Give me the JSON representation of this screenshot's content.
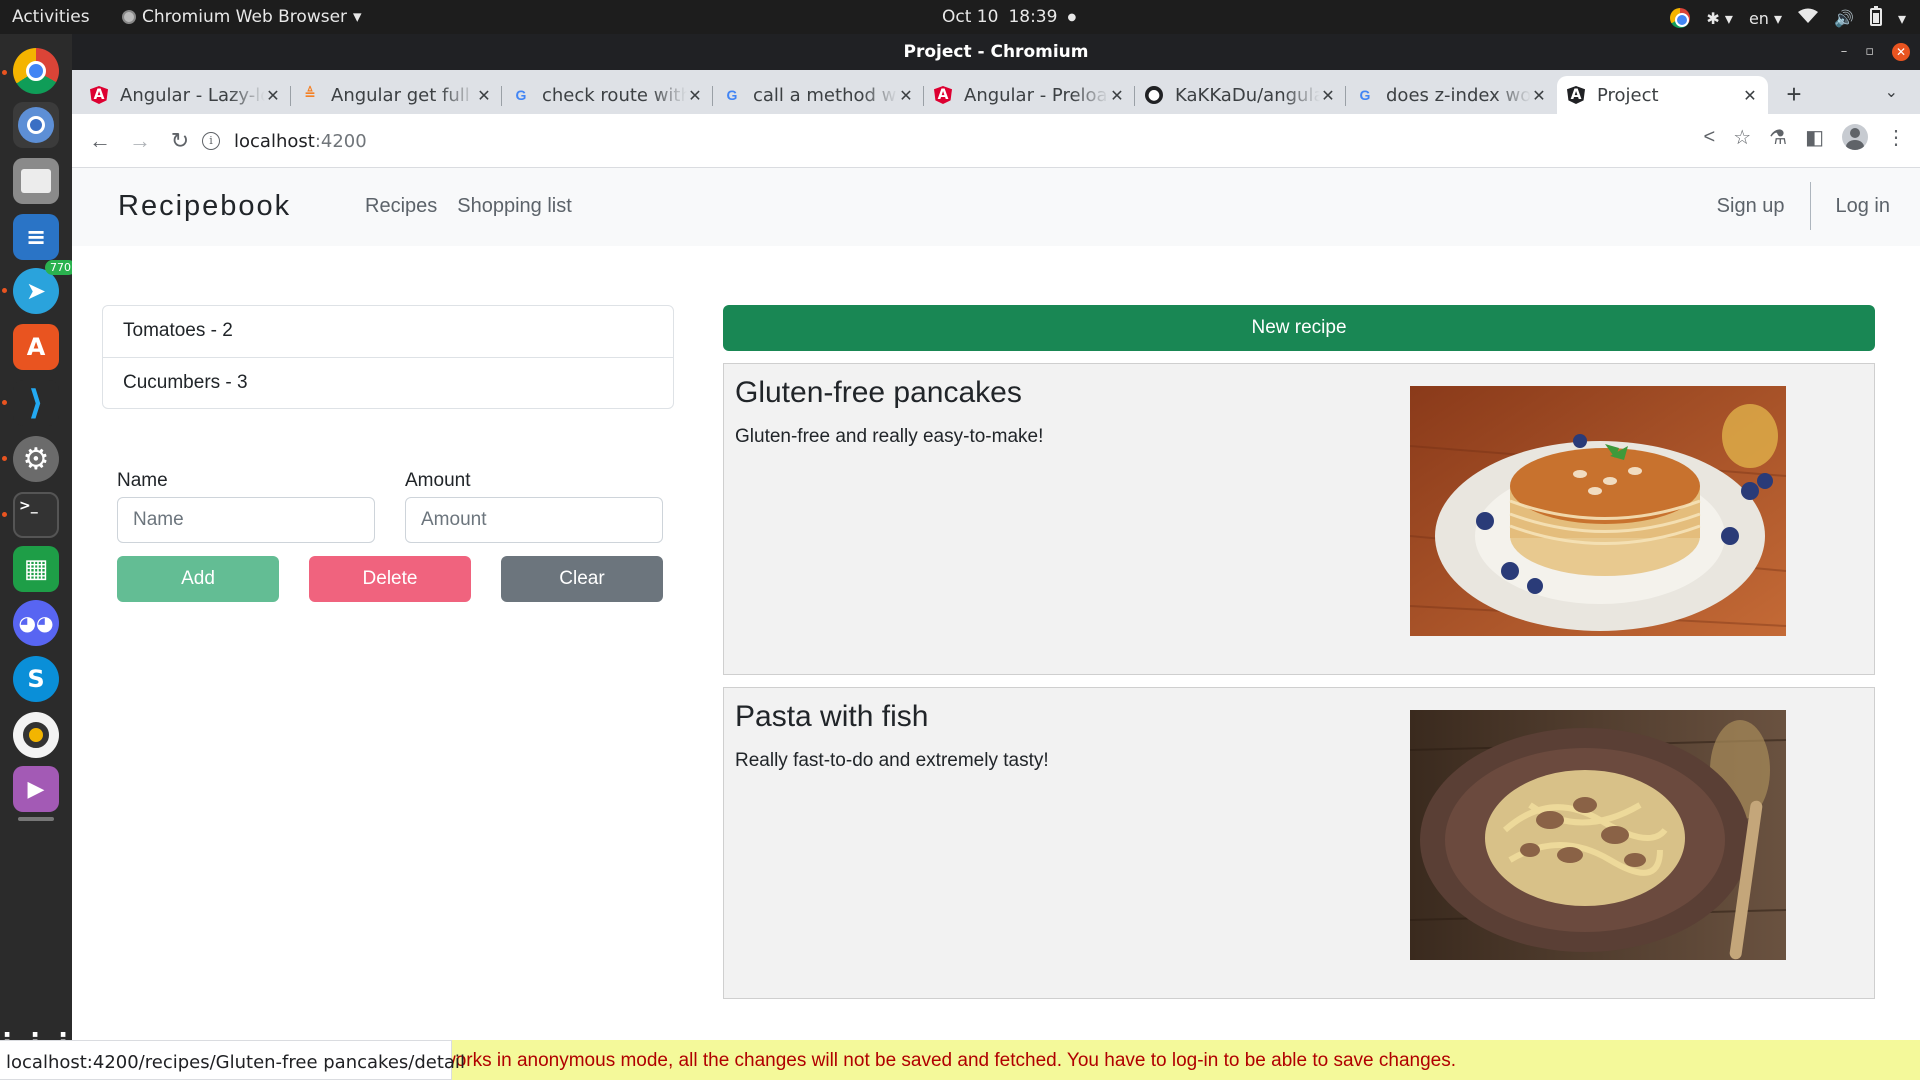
{
  "system": {
    "activities": "Activities",
    "app_name": "Chromium Web Browser",
    "date": "Oct 10",
    "time": "18:39",
    "language": "en"
  },
  "dock": {
    "telegram_badge": "770"
  },
  "window": {
    "title": "Project - Chromium"
  },
  "tabs": [
    {
      "title": "Angular - Lazy-loading",
      "icon": "angular-icon"
    },
    {
      "title": "Angular get full url",
      "icon": "stackoverflow-icon"
    },
    {
      "title": "check route with",
      "icon": "google-icon"
    },
    {
      "title": "call a method when",
      "icon": "google-icon"
    },
    {
      "title": "Angular - Preloading",
      "icon": "angular-icon"
    },
    {
      "title": "KaKKaDu/angular",
      "icon": "github-icon"
    },
    {
      "title": "does z-index work",
      "icon": "google-icon"
    },
    {
      "title": "Project",
      "icon": "angular-icon",
      "active": true
    }
  ],
  "address_bar": {
    "host": "localhost",
    "port": ":4200"
  },
  "app": {
    "brand": "Recipebook",
    "nav": {
      "recipes": "Recipes",
      "shopping_list": "Shopping list"
    },
    "auth": {
      "signup": "Sign up",
      "login": "Log in"
    },
    "ingredients": [
      "Tomatoes - 2",
      "Cucumbers - 3"
    ],
    "form": {
      "name_label": "Name",
      "name_placeholder": "Name",
      "amount_label": "Amount",
      "amount_placeholder": "Amount",
      "add_label": "Add",
      "delete_label": "Delete",
      "clear_label": "Clear"
    },
    "new_recipe_label": "New recipe",
    "recipes": [
      {
        "title": "Gluten-free pancakes",
        "description": "Gluten-free and really easy-to-make!",
        "image": "pancakes-image"
      },
      {
        "title": "Pasta with fish",
        "description": "Really fast-to-do and extremely tasty!",
        "image": "pasta-image"
      }
    ]
  },
  "status_url": "localhost:4200/recipes/Gluten-free pancakes/detail",
  "notice": "works in anonymous mode, all the changes will not be saved and fetched. You have to log-in to be able to save changes.",
  "colors": {
    "success": "#198754",
    "danger": "#f0637e",
    "secondary": "#6c757d",
    "notice_bg": "#f4f99a",
    "notice_text": "#b00000"
  }
}
